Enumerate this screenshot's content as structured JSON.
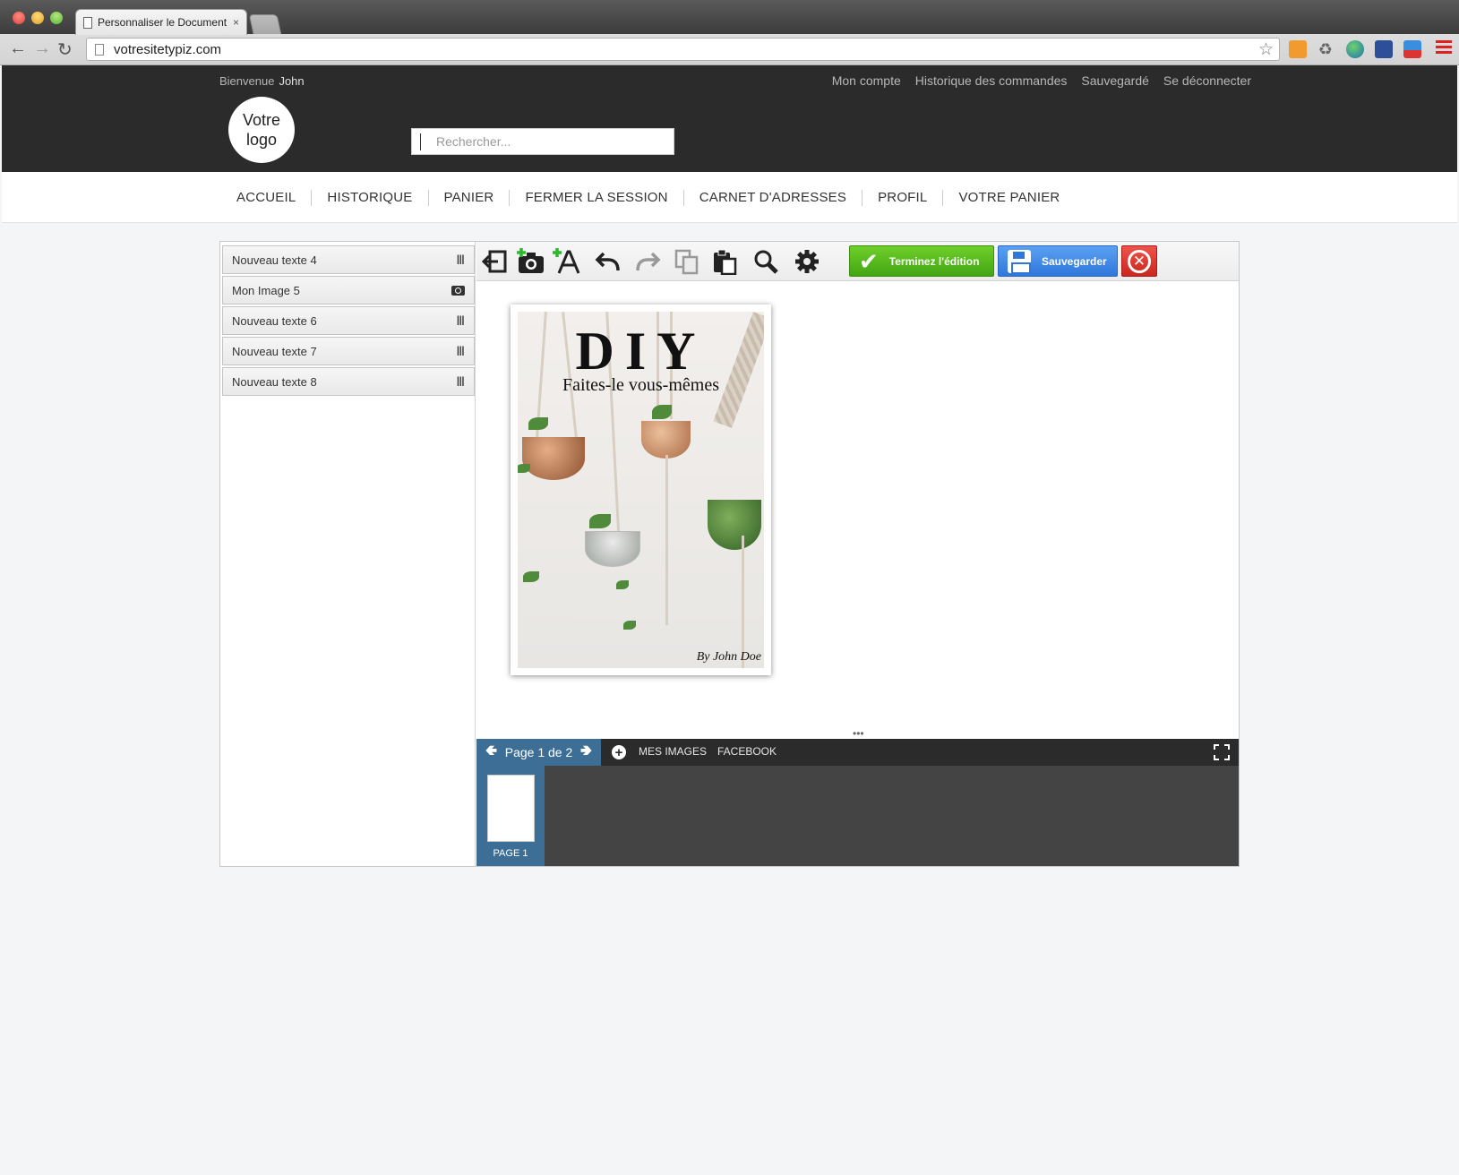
{
  "browser": {
    "tab_title": "Personnaliser le Document",
    "tab_close": "×",
    "url": "votresitetypiz.com"
  },
  "header": {
    "welcome": "Bienvenue",
    "user": "John",
    "links": [
      "Mon compte",
      "Historique des commandes",
      "Sauvegardé",
      "Se déconnecter"
    ],
    "logo": "Votre logo",
    "search_placeholder": "Rechercher..."
  },
  "nav": [
    "ACCUEIL",
    "HISTORIQUE",
    "PANIER",
    "FERMER LA SESSION",
    "CARNET D'ADRESSES",
    "PROFIL",
    "VOTRE PANIER"
  ],
  "layers": [
    {
      "label": "Nouveau texte 4",
      "icon": "text-cursor-icon"
    },
    {
      "label": "Mon Image 5",
      "icon": "camera-icon"
    },
    {
      "label": "Nouveau texte 6",
      "icon": "text-cursor-icon"
    },
    {
      "label": "Nouveau texte 7",
      "icon": "text-cursor-icon"
    },
    {
      "label": "Nouveau texte 8",
      "icon": "text-cursor-icon"
    }
  ],
  "toolbar": {
    "finish_label": "Terminez l'édition",
    "save_label": "Sauvegarder"
  },
  "document": {
    "title": "DIY",
    "subtitle": "Faites-le vous-mêmes",
    "author": "By John Doe"
  },
  "pages": {
    "indicator": "Page 1 de 2",
    "links": [
      "MES IMAGES",
      "FACEBOOK"
    ],
    "thumb_label": "PAGE 1"
  },
  "colors": {
    "header_bg": "#2b2b2b",
    "finish_green": "#4cb41a",
    "save_blue": "#3b82e6",
    "close_red": "#d9342b",
    "page_nav_blue": "#3d6f96"
  }
}
